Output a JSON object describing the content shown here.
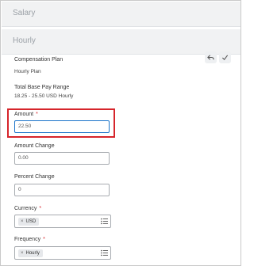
{
  "panels": {
    "salary_title": "Salary",
    "hourly_title": "Hourly"
  },
  "compensation_plan": {
    "label": "Compensation Plan",
    "value": "Hourly Plan"
  },
  "total_base_pay_range": {
    "label": "Total Base Pay Range",
    "value": "18.25 - 25.50 USD Hourly"
  },
  "amount": {
    "label": "Amount",
    "required_marker": "*",
    "value": "22.50"
  },
  "amount_change": {
    "label": "Amount Change",
    "value": "0.00"
  },
  "percent_change": {
    "label": "Percent Change",
    "value": "0"
  },
  "currency": {
    "label": "Currency",
    "required_marker": "*",
    "selected": "USD",
    "remove_glyph": "×"
  },
  "frequency": {
    "label": "Frequency",
    "required_marker": "*",
    "selected": "Hourly",
    "remove_glyph": "×"
  },
  "icons": {
    "undo": "undo-icon",
    "confirm": "checkmark-icon",
    "list": "list-icon"
  },
  "colors": {
    "required": "#d6252b",
    "focus_border": "#1b74c9",
    "highlight": "#d6252b",
    "header_bg": "#f1f2f3"
  }
}
